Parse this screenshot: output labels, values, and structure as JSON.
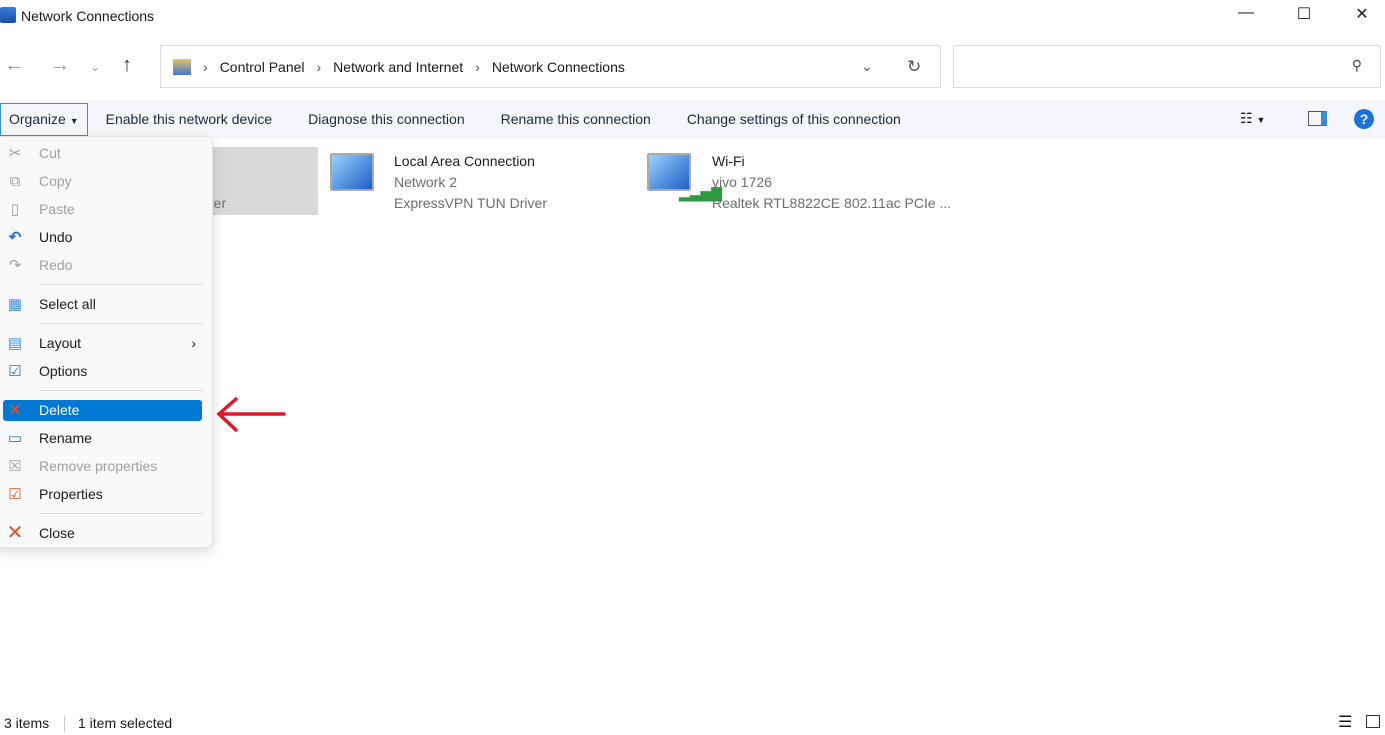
{
  "window": {
    "title": "Network Connections"
  },
  "address": {
    "crumbs": [
      "Control Panel",
      "Network and Internet",
      "Network Connections"
    ],
    "search_placeholder": ""
  },
  "toolbar": {
    "organize": "Organize",
    "buttons": [
      "Enable this network device",
      "Diagnose this connection",
      "Rename this connection",
      "Change settings of this connection"
    ]
  },
  "items": [
    {
      "name": "",
      "line1": "",
      "line2": "pter",
      "selected": true
    },
    {
      "name": "Local Area Connection",
      "line1": "Network 2",
      "line2": "ExpressVPN TUN Driver"
    },
    {
      "name": "Wi-Fi",
      "line1": "vivo 1726",
      "line2": "Realtek RTL8822CE 802.11ac PCIe ..."
    }
  ],
  "menu": {
    "items": [
      {
        "label": "Cut",
        "icon": "scissors-icon",
        "disabled": true
      },
      {
        "label": "Copy",
        "icon": "copy-icon",
        "disabled": true
      },
      {
        "label": "Paste",
        "icon": "paste-icon",
        "disabled": true
      },
      {
        "label": "Undo",
        "icon": "undo-icon"
      },
      {
        "label": "Redo",
        "icon": "redo-icon",
        "disabled": true
      },
      {
        "label": "Select all",
        "icon": "select-all-icon"
      },
      {
        "label": "Layout",
        "icon": "layout-icon",
        "submenu": true
      },
      {
        "label": "Options",
        "icon": "options-icon"
      },
      {
        "label": "Delete",
        "icon": "delete-icon",
        "highlighted": true
      },
      {
        "label": "Rename",
        "icon": "rename-icon"
      },
      {
        "label": "Remove properties",
        "icon": "remove-properties-icon",
        "disabled": true
      },
      {
        "label": "Properties",
        "icon": "properties-icon"
      },
      {
        "label": "Close",
        "icon": "close-icon"
      }
    ]
  },
  "status": {
    "count": "3 items",
    "selected": "1 item selected"
  },
  "colors": {
    "accent": "#0078d4",
    "annotation_arrow": "#e0162b"
  }
}
